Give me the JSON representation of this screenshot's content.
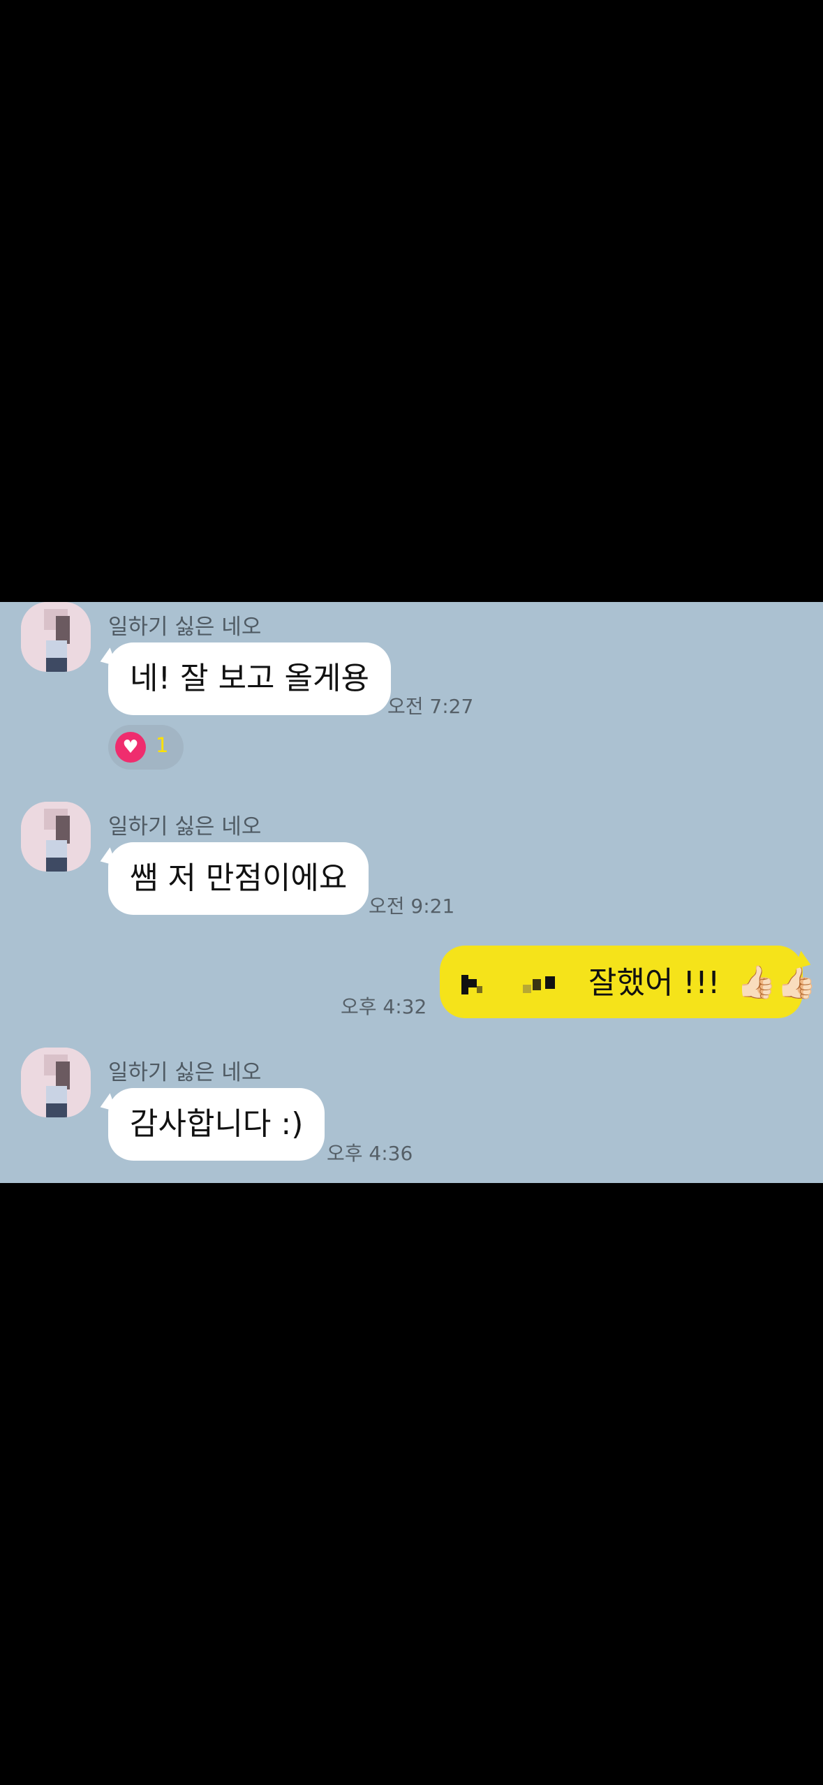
{
  "messages": [
    {
      "sender": "일하기 싫은 네오",
      "text": "네! 잘 보고 올게용",
      "time": "오전 7:27",
      "reaction": {
        "icon": "heart-icon",
        "count": "1",
        "color": "#ef2d6e"
      }
    },
    {
      "sender": "일하기 싫은 네오",
      "text": "쌤 저 만점이에요",
      "time": "오전 9:21"
    },
    {
      "sender": "me",
      "text": "잘했어 !!!",
      "emoji": "👍🏻👍🏻",
      "time": "오후 4:32"
    },
    {
      "sender": "일하기 싫은 네오",
      "text": "감사합니다 :)",
      "time": "오후 4:36"
    }
  ],
  "colors": {
    "background": "#abc1d1",
    "incoming_bubble": "#ffffff",
    "outgoing_bubble": "#f5e31a"
  }
}
